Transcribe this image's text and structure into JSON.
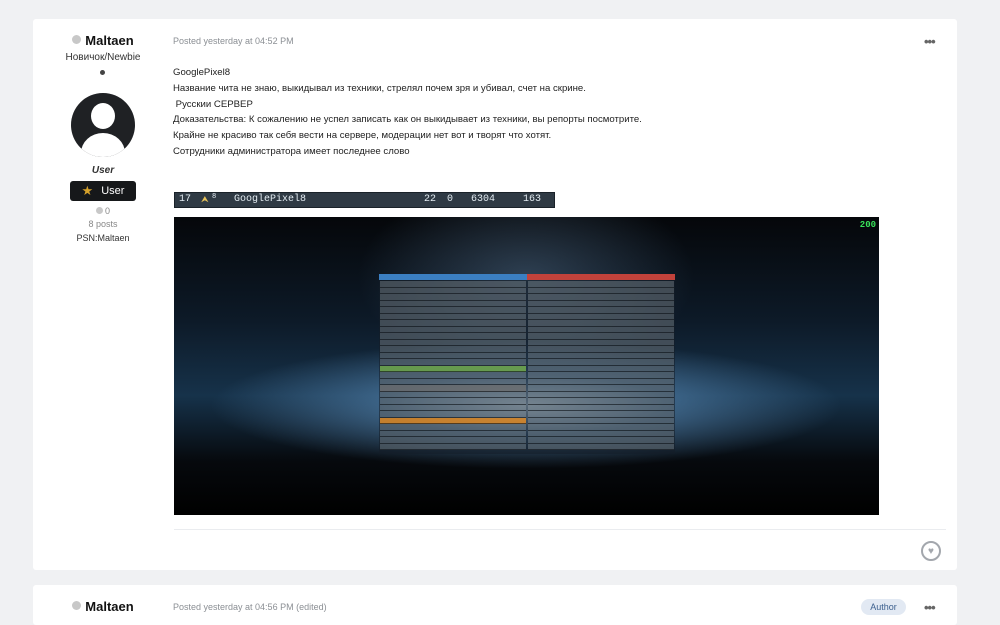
{
  "post1": {
    "author": {
      "name": "Maltaen",
      "rank": "Новичок/Newbie",
      "group": "User",
      "badge_label": "User",
      "reputation": "0",
      "posts": "8 posts",
      "psn": "PSN:Maltaen"
    },
    "meta": "Posted yesterday at 04:52 PM",
    "more_icon": "ellipsis-icon",
    "body_lines": [
      "GooglePixel8",
      "Название чита не знаю, выкидывал из техники, стрелял почем зря и убивал, счет на скрине.",
      " Русскии СЕРВЕР",
      "Доказательства: К сожалению не успел записать как он выкидывает из техники, вы репорты посмотрите.",
      "Крайне не красиво так себя вести на сервере, модерации нет вот и творят что хотят.",
      "Сотрудники администратора имеет последнее слово"
    ],
    "scorebar": {
      "rank_num": "17",
      "rank_small": "8",
      "player": "GooglePixel8",
      "kills": "22",
      "deaths": "0",
      "score": "6304",
      "ping": "163"
    },
    "screenshot": {
      "fps": "200"
    },
    "reaction_icon": "heart-icon"
  },
  "post2": {
    "author": {
      "name": "Maltaen"
    },
    "meta": "Posted yesterday at 04:56 PM (edited)",
    "author_badge": "Author"
  },
  "colors": {
    "page_bg": "#f0f1f3",
    "card_bg": "#ffffff",
    "badge_bg": "#16181a",
    "star": "#d6a22b",
    "fps_green": "#39e05a",
    "team_blue": "#3b7fc2",
    "team_red": "#c2423b"
  }
}
